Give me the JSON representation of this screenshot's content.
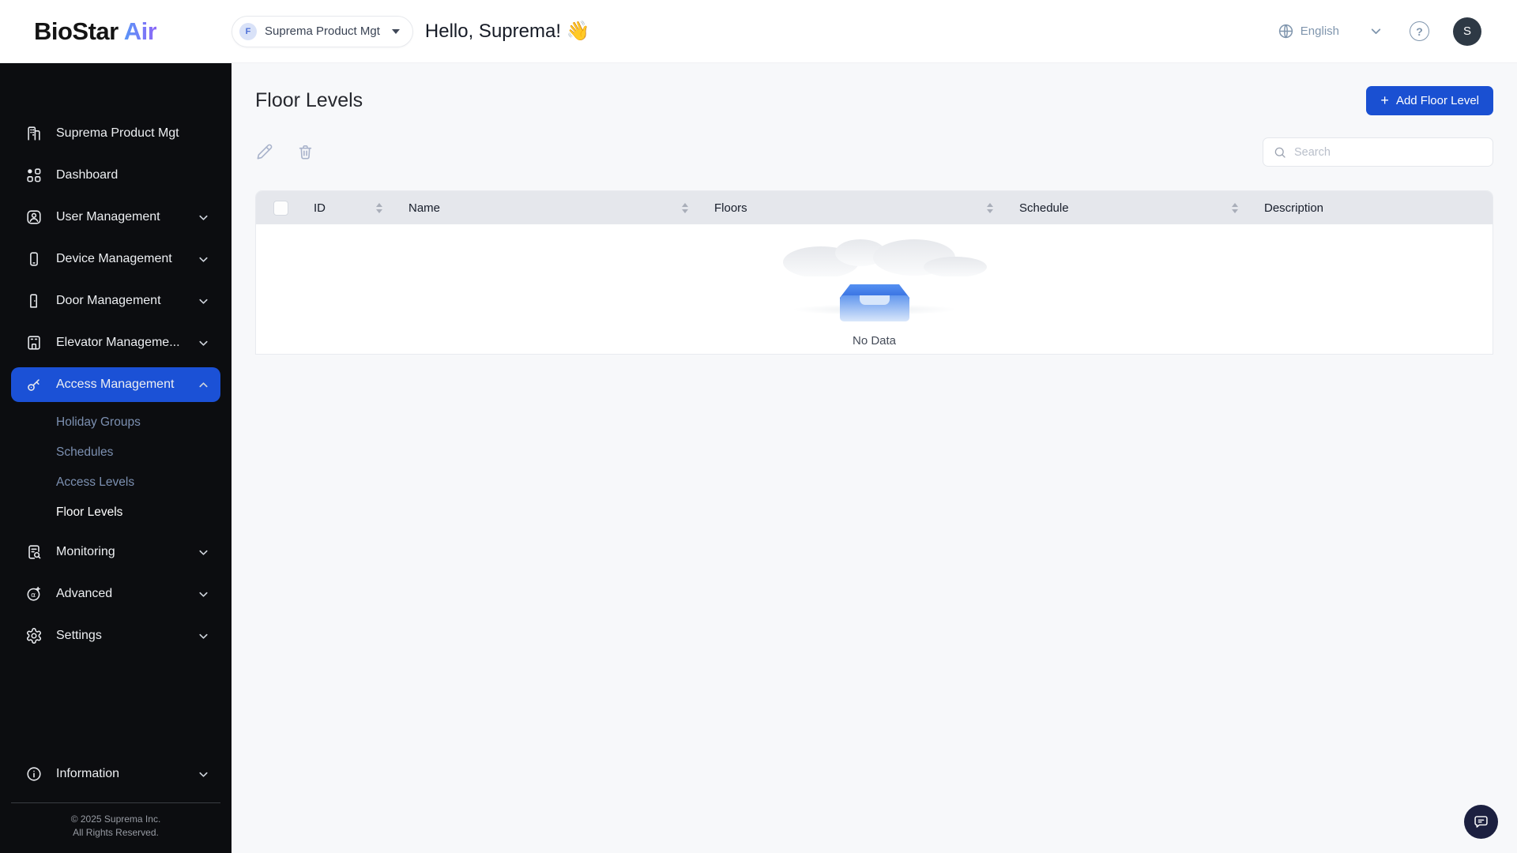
{
  "colors": {
    "accent_blue": "#1b51d6",
    "button_blue": "#1a50d2",
    "sidebar_bg": "#0c0d10",
    "logo_gradient_start": "#4f9df7",
    "logo_gradient_end": "#8d68f7",
    "sidebar_muted_link": "#7c90b1",
    "header_icon_gray_blue": "#7f95ad",
    "table_header_bg": "#e5e7ec",
    "chat_fab_bg": "#1c2040"
  },
  "header": {
    "logo_part1": "BioStar",
    "logo_part2": " Air",
    "org_selector": {
      "badge": "F",
      "label": "Suprema Product Mgt"
    },
    "greeting": "Hello, Suprema! 👋",
    "language": "English",
    "help_glyph": "?",
    "avatar_initial": "S"
  },
  "sidebar": {
    "items": [
      {
        "label": "Suprema Product Mgt"
      },
      {
        "label": "Dashboard"
      },
      {
        "label": "User Management"
      },
      {
        "label": "Device Management"
      },
      {
        "label": "Door Management"
      },
      {
        "label": "Elevator Manageme..."
      },
      {
        "label": "Access Management",
        "children": [
          "Holiday Groups",
          "Schedules",
          "Access Levels",
          "Floor Levels"
        ],
        "active_child": "Floor Levels"
      },
      {
        "label": "Monitoring"
      },
      {
        "label": "Advanced"
      },
      {
        "label": "Settings"
      },
      {
        "label": "Information"
      }
    ],
    "footer_line1": "© 2025 Suprema Inc.",
    "footer_line2": "All Rights Reserved."
  },
  "main": {
    "title": "Floor Levels",
    "add_button": {
      "plus": "+",
      "label": "Add Floor Level"
    },
    "search_placeholder": "Search",
    "table": {
      "columns": [
        "ID",
        "Name",
        "Floors",
        "Schedule",
        "Description"
      ]
    },
    "empty_state": "No Data"
  }
}
